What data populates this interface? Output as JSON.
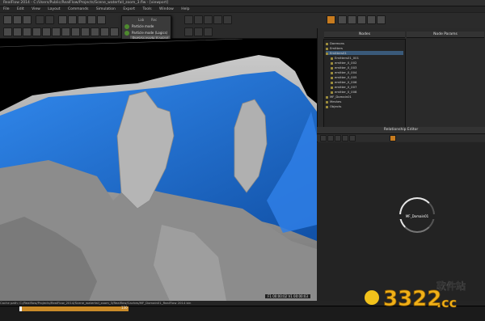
{
  "titlebar": {
    "text": "RealFlow 2014 - C:/Users/Public/RealFlow/Projects/Scene_waterfall_zoom_3.flw - [viewport]"
  },
  "menubar": [
    "File",
    "Edit",
    "View",
    "Layout",
    "Commands",
    "Simulation",
    "Export",
    "Tools",
    "Window",
    "Help"
  ],
  "popup": {
    "items": [
      "Particle mode",
      "Particle mode (Logics)",
      "Particle mode (Logics)"
    ],
    "selected_index": 2,
    "header": "Lab",
    "header2": "Rec"
  },
  "right_panel": {
    "left_header": "Nodes",
    "right_header": "Node Params",
    "outliner_items": [
      "Daemons",
      "Emitters",
      "Emitters01",
      "Emitters01_001",
      "emitter_0_002",
      "emitter_0_003",
      "emitter_0_004",
      "emitter_0_005",
      "emitter_0_006",
      "emitter_0_007",
      "emitter_0_008",
      "MF_Domain01",
      "Meshes",
      "Objects"
    ],
    "relationship_header": "Relationship Editor",
    "node_label": "MF_Domain01"
  },
  "viewport": {
    "hud": "F1 00:00:02 V1 00:00:03"
  },
  "statusbar": {
    "text": "Cache path: C:/Realflow/Projects/RealFlow_2014/Scene_waterfall_zoom_3/Realflow/Caches/MF_Domain01_RealFlow 2014 bin"
  },
  "timeline": {
    "current_frame": "130"
  },
  "watermark": {
    "brand": "3322",
    "cn": "软件站",
    "domain": ".cc"
  },
  "colors": {
    "accent_orange": "#c98a28",
    "water_blue": "#1a6fd6",
    "terrain_grey": "#9a9a9a"
  }
}
